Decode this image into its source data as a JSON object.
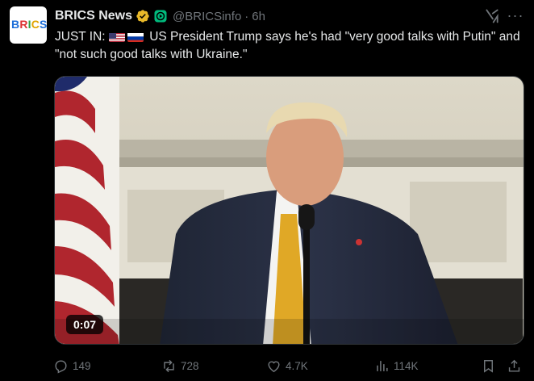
{
  "author": {
    "display_name": "BRICS News",
    "handle": "@BRICSinfo",
    "separator": "·",
    "time": "6h",
    "avatar_text": [
      "B",
      "R",
      "I",
      "C",
      "S"
    ]
  },
  "tweet": {
    "text_prefix": "JUST IN:",
    "text_body": " US President Trump says he's had \"very good talks with Putin\" and \"not such good talks with Ukraine.\"",
    "flags": [
      "us-flag-icon",
      "ru-flag-icon"
    ]
  },
  "media": {
    "type": "video",
    "duration": "0:07"
  },
  "actions": {
    "replies": "149",
    "reposts": "728",
    "likes": "4.7K",
    "views": "114K"
  },
  "colors": {
    "background": "#000000",
    "text": "#e7e9ea",
    "muted": "#71767b",
    "verified_gold": "#e8b829",
    "affiliate_green": "#00ba7c"
  }
}
